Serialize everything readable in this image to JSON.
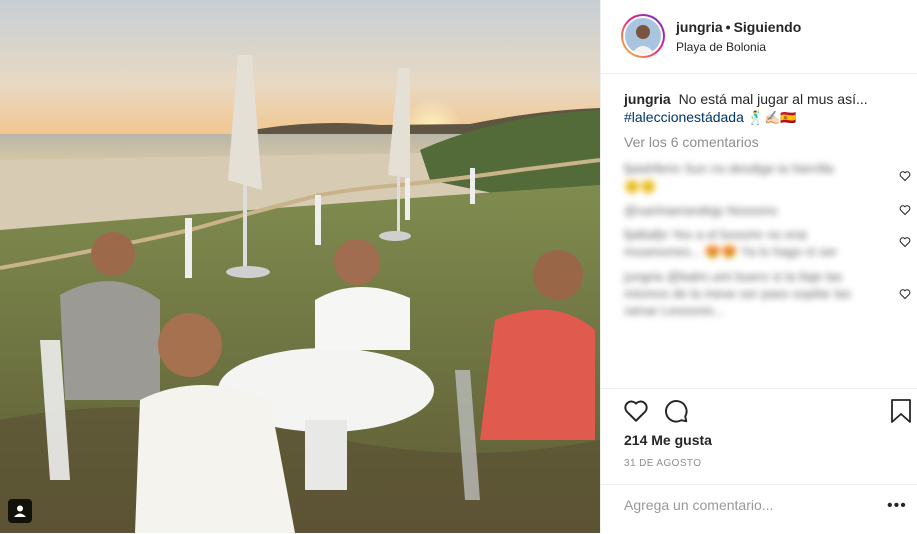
{
  "post": {
    "username": "jungria",
    "follow_status": "Siguiendo",
    "separator": "•",
    "location": "Playa de Bolonia"
  },
  "caption": {
    "username": "jungria",
    "text": "No está mal jugar al mus así...",
    "hashtag": "#laleccionestádada",
    "emojis": "🕺✍🏻🇪🇸"
  },
  "comments": {
    "view_all": "Ver los 6 comentarios",
    "blurred": [
      "fjaiahferio Sun no desdige la hierrilla",
      "🙂🙂",
      "@sanhaerandejp Nosssno",
      "fjaltiafjn Yes a el bxsomr no erai musesones... 😍😍 Ya lo hago ni ser",
      "jungria @balm.uini buero si la llaje las mismos de la mese ser pass sopilar las ramar Lessonio..."
    ]
  },
  "stats": {
    "likes": "214 Me gusta",
    "date": "31 DE AGOSTO"
  },
  "comment_input": {
    "placeholder": "Agrega un comentario..."
  },
  "icons": {
    "like": "heart-icon",
    "comment": "comment-bubble-icon",
    "save": "bookmark-icon",
    "more": "ellipsis-icon",
    "tagged": "user-tag-icon"
  },
  "colors": {
    "link": "#003569",
    "muted": "#8e8e8e",
    "text": "#262626",
    "border": "#efefef"
  }
}
